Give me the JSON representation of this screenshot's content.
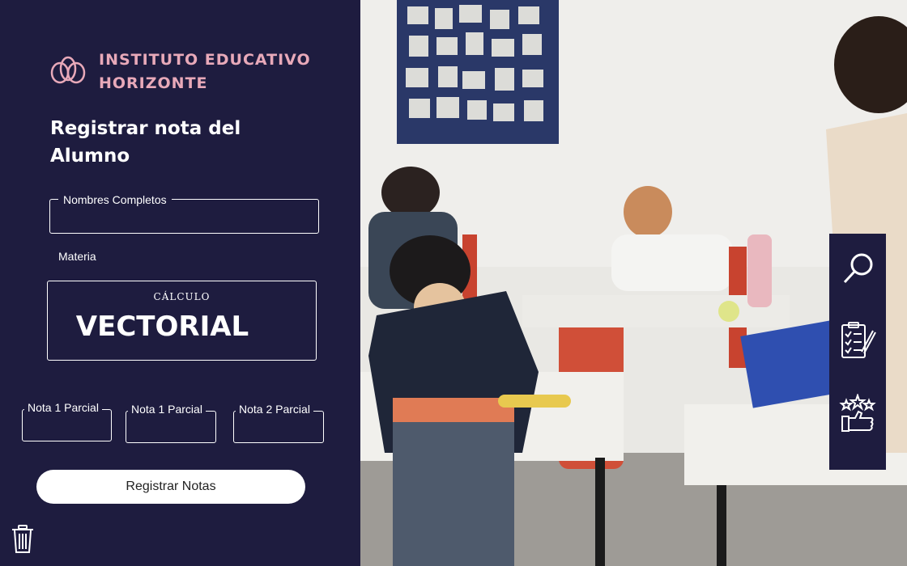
{
  "brand": {
    "line1": "INSTITUTO EDUCATIVO",
    "line2": "HORIZONTE",
    "color": "#e8a9b9"
  },
  "form": {
    "title": "Registrar nota del Alumno",
    "nombres_label": "Nombres Completos",
    "nombres_value": "",
    "materia_label": "Materia",
    "materia_line1": "CÁLCULO",
    "materia_line2": "VECTORIAL",
    "nota1_label": "Nota 1 Parcial",
    "nota2_label": "Nota 1 Parcial",
    "nota3_label": "Nota 2 Parcial",
    "submit_label": "Registrar Notas"
  },
  "toolbar": {
    "icons": [
      "search-icon",
      "checklist-icon",
      "rating-icon"
    ]
  },
  "colors": {
    "panel": "#1e1c3f",
    "accent": "#e8a9b9",
    "text": "#ffffff"
  }
}
